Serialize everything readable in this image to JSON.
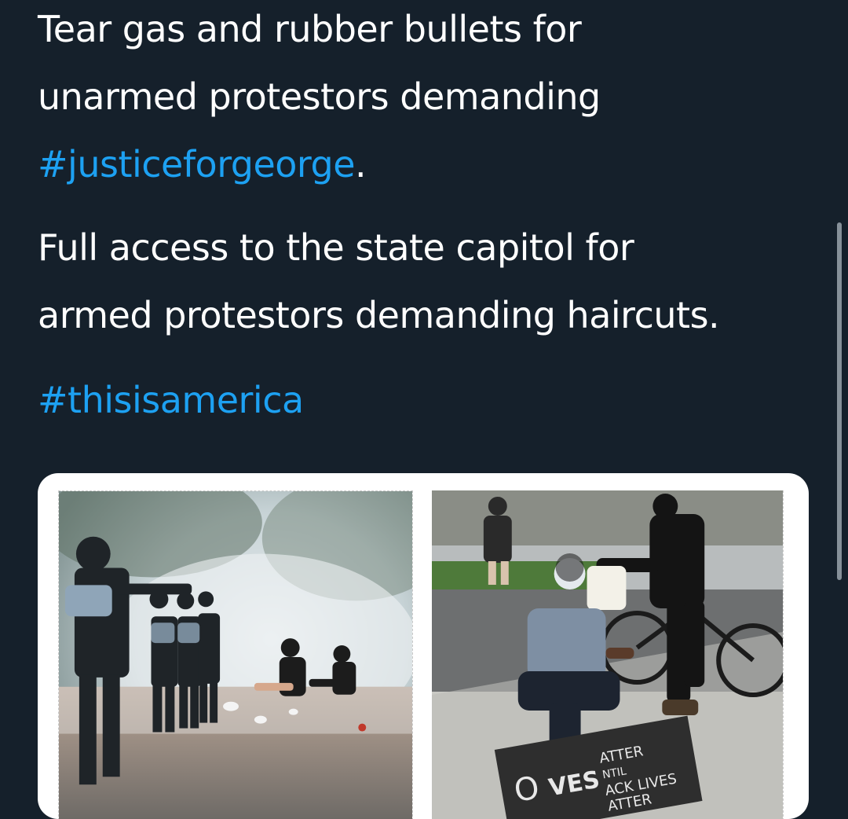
{
  "tweet": {
    "line1": "Tear gas and rubber bullets for",
    "line2": "unarmed protestors demanding",
    "hashtag1": "#justiceforgeorge",
    "hashtag1_suffix": ".",
    "line3": "Full access to the state capitol for",
    "line4": "armed protestors demanding haircuts.",
    "hashtag2": "#thisisamerica"
  },
  "media": {
    "photo_left": "tear-gas-police-scene",
    "photo_right": "kneeling-protestor-scene",
    "sign_text": {
      "a": "O",
      "b": "VES",
      "c": "ATTER",
      "d": "NTIL",
      "e": "ACK LIVES",
      "f": "ATTER"
    }
  },
  "colors": {
    "background": "#15202b",
    "text": "#ffffff",
    "hashtag": "#1da1f2",
    "card": "#ffffff"
  }
}
